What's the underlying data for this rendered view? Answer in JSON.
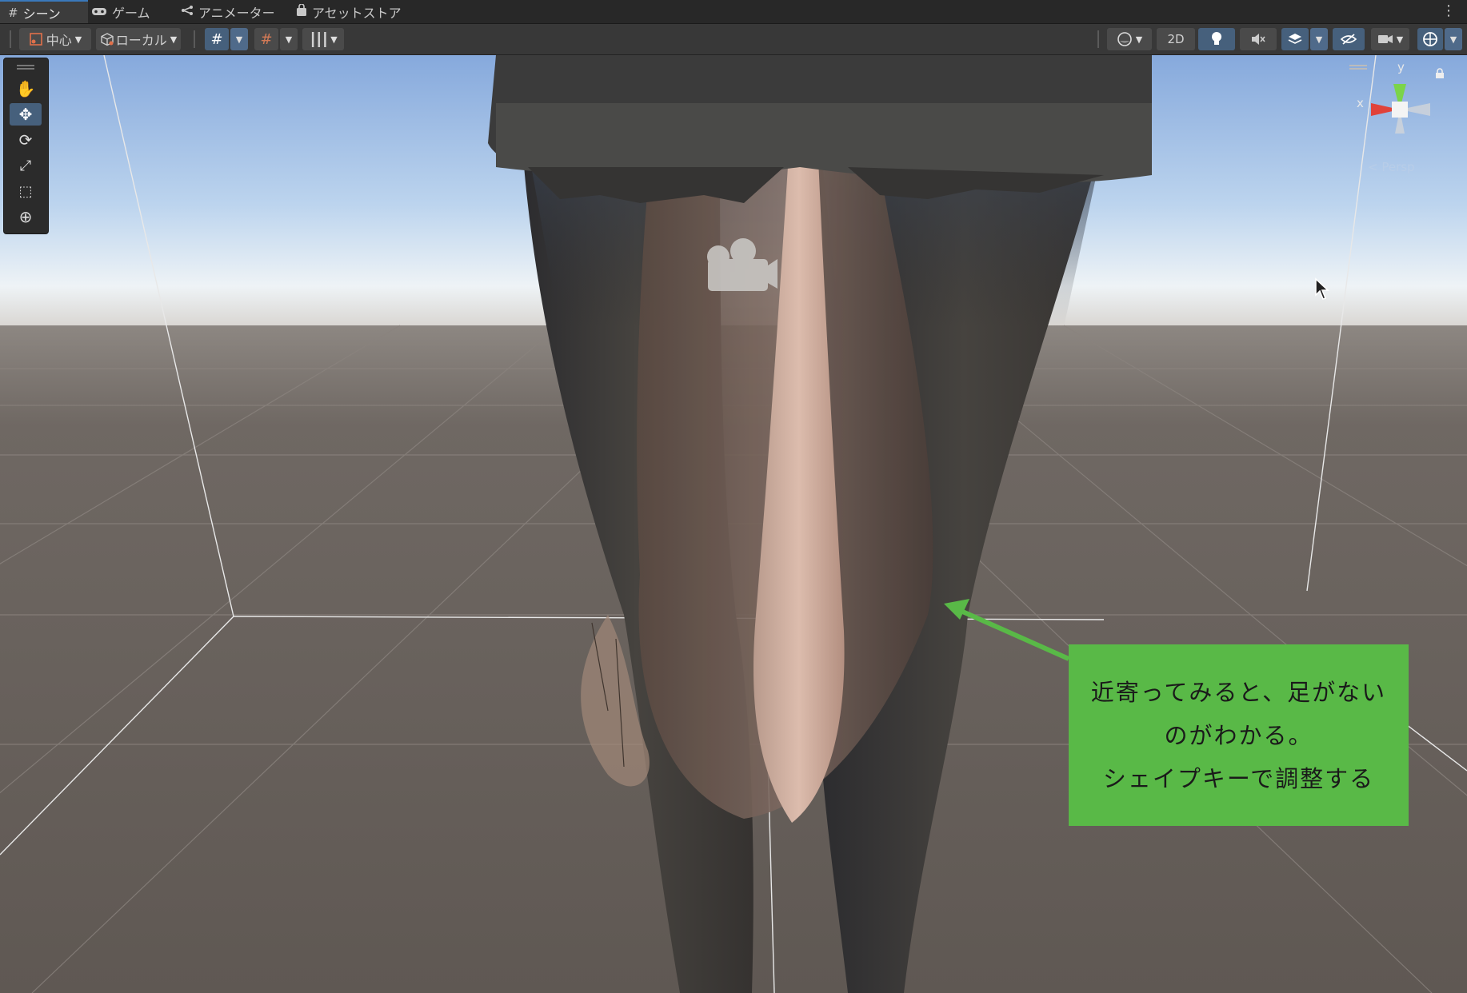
{
  "tabs": [
    {
      "label": "シーン",
      "icon": "grid-icon"
    },
    {
      "label": "ゲーム",
      "icon": "gamepad-icon"
    },
    {
      "label": "アニメーター",
      "icon": "animator-icon"
    },
    {
      "label": "アセットストア",
      "icon": "store-bag-icon"
    }
  ],
  "toolbar": {
    "pivot_label": "中心",
    "space_label": "ローカル",
    "mode_2d_label": "2D"
  },
  "gizmo": {
    "y_label": "y",
    "x_label": "x",
    "persp_label": "< Persp"
  },
  "annotation": {
    "line1": "近寄ってみると、足がない",
    "line2": "のがわかる。",
    "line3": "シェイプキーで調整する",
    "color": "#59b947"
  },
  "colors": {
    "accent": "#3a79bb",
    "active_button": "#46607c",
    "ground": "#645d58",
    "sky_top": "#8aaee0"
  }
}
